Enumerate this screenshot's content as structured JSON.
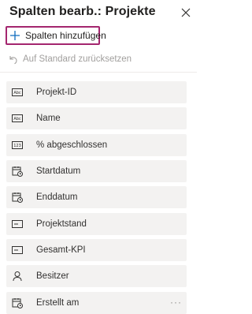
{
  "panel": {
    "title": "Spalten bearb.: Projekte"
  },
  "actions": {
    "add_columns": "Spalten hinzufügen",
    "reset_default": "Auf Standard zurücksetzen"
  },
  "columns": [
    {
      "label": "Projekt-ID",
      "icon": "text-field-icon"
    },
    {
      "label": "Name",
      "icon": "text-field-icon"
    },
    {
      "label": "% abgeschlossen",
      "icon": "number-field-icon"
    },
    {
      "label": "Startdatum",
      "icon": "calendar-icon"
    },
    {
      "label": "Enddatum",
      "icon": "calendar-icon"
    },
    {
      "label": "Projektstand",
      "icon": "choice-field-icon"
    },
    {
      "label": "Gesamt-KPI",
      "icon": "choice-field-icon"
    },
    {
      "label": "Besitzer",
      "icon": "person-icon"
    },
    {
      "label": "Erstellt am",
      "icon": "calendar-icon"
    }
  ],
  "more_options": "···",
  "colors": {
    "accent_border": "#a4266f",
    "add_icon": "#0f6cbd",
    "item_bg": "#f3f2f1",
    "disabled_text": "#a19f9d"
  }
}
